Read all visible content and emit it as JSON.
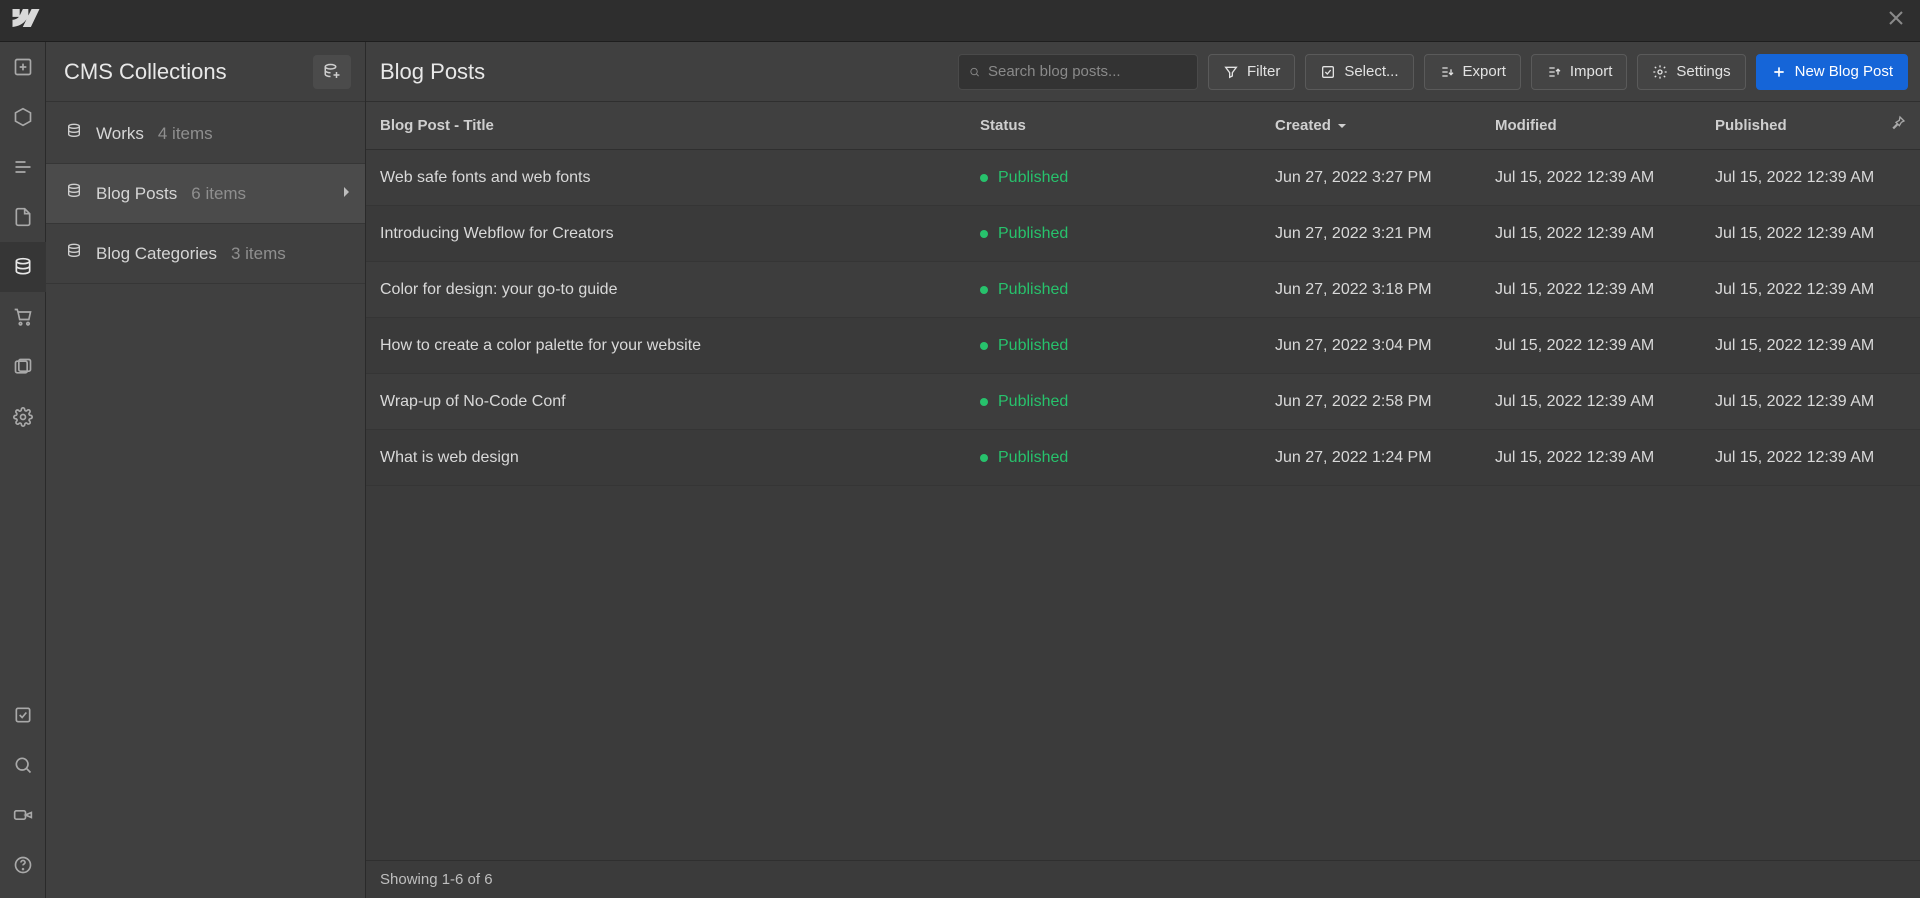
{
  "top": {
    "close_title": "Close"
  },
  "rail": {
    "items_top": [
      "add",
      "elements",
      "navigator",
      "pages",
      "cms",
      "ecommerce",
      "assets",
      "settings"
    ],
    "items_bottom": [
      "audits",
      "search",
      "video",
      "help"
    ]
  },
  "sidebar": {
    "title": "CMS Collections",
    "collections": [
      {
        "label": "Works",
        "count": "4 items"
      },
      {
        "label": "Blog Posts",
        "count": "6 items"
      },
      {
        "label": "Blog Categories",
        "count": "3 items"
      }
    ],
    "active_index": 1
  },
  "main": {
    "title": "Blog Posts",
    "search_placeholder": "Search blog posts...",
    "buttons": {
      "filter": "Filter",
      "select": "Select...",
      "export": "Export",
      "import": "Import",
      "settings": "Settings",
      "new": "New Blog Post"
    },
    "columns": {
      "title": "Blog Post - Title",
      "status": "Status",
      "created": "Created",
      "modified": "Modified",
      "published": "Published"
    },
    "sort": {
      "column": "created",
      "dir": "desc"
    },
    "rows": [
      {
        "title": "Web safe fonts and web fonts",
        "status": "Published",
        "created": "Jun 27, 2022 3:27 PM",
        "modified": "Jul 15, 2022 12:39 AM",
        "published": "Jul 15, 2022 12:39 AM"
      },
      {
        "title": "Introducing Webflow for Creators",
        "status": "Published",
        "created": "Jun 27, 2022 3:21 PM",
        "modified": "Jul 15, 2022 12:39 AM",
        "published": "Jul 15, 2022 12:39 AM"
      },
      {
        "title": "Color for design: your go-to guide",
        "status": "Published",
        "created": "Jun 27, 2022 3:18 PM",
        "modified": "Jul 15, 2022 12:39 AM",
        "published": "Jul 15, 2022 12:39 AM"
      },
      {
        "title": "How to create a color palette for your website",
        "status": "Published",
        "created": "Jun 27, 2022 3:04 PM",
        "modified": "Jul 15, 2022 12:39 AM",
        "published": "Jul 15, 2022 12:39 AM"
      },
      {
        "title": "Wrap-up of No-Code Conf",
        "status": "Published",
        "created": "Jun 27, 2022 2:58 PM",
        "modified": "Jul 15, 2022 12:39 AM",
        "published": "Jul 15, 2022 12:39 AM"
      },
      {
        "title": "What is web design",
        "status": "Published",
        "created": "Jun 27, 2022 1:24 PM",
        "modified": "Jul 15, 2022 12:39 AM",
        "published": "Jul 15, 2022 12:39 AM"
      }
    ],
    "footer": "Showing 1-6 of 6"
  },
  "colors": {
    "published": "#27c26c",
    "primary": "#1565d8"
  }
}
